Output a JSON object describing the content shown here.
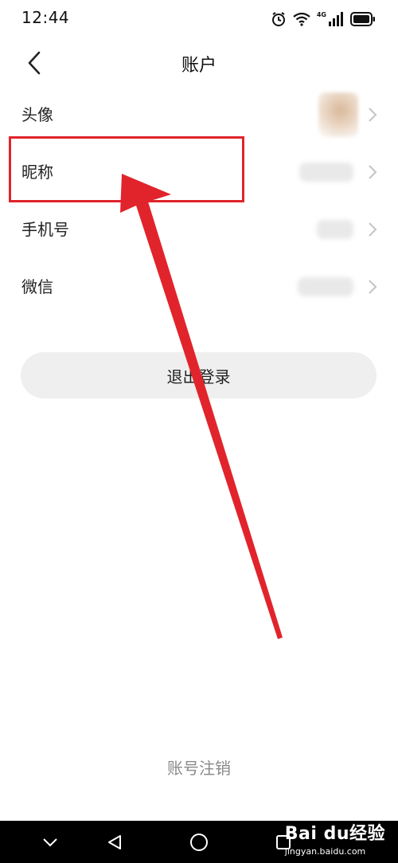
{
  "status_bar": {
    "time": "12:44",
    "network_label": "4G",
    "icons": [
      "alarm-icon",
      "wifi-icon",
      "signal-icon",
      "battery-icon"
    ]
  },
  "nav": {
    "title": "账户",
    "back_icon": "chevron-left-icon"
  },
  "rows": [
    {
      "label": "头像",
      "value_type": "avatar"
    },
    {
      "label": "昵称",
      "value_type": "blurred-text"
    },
    {
      "label": "手机号",
      "value_type": "blurred-text"
    },
    {
      "label": "微信",
      "value_type": "blurred-text"
    }
  ],
  "logout_button": {
    "label": "退出登录"
  },
  "cancel_account_link": {
    "label": "账号注销"
  },
  "annotation": {
    "color": "#e1242b"
  },
  "system_nav": {
    "buttons": [
      "chevron-down-icon",
      "back-triangle-icon",
      "home-circle-icon",
      "recents-square-icon"
    ]
  },
  "watermark": {
    "brand": "Bai du经验",
    "url": "jingyan.baidu.com"
  },
  "colors": {
    "accent": "#e1242b",
    "button_bg": "#efefef",
    "muted_text": "#8a8a8a"
  }
}
